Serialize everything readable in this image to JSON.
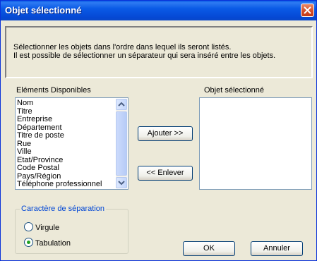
{
  "window": {
    "title": "Objet sélectionné"
  },
  "info": {
    "line1": "Sélectionner les objets dans l'ordre dans lequel ils seront listés.",
    "line2": "Il est possible de sélectionner un séparateur qui sera inséré entre les objets."
  },
  "available": {
    "label": "Eléments Disponibles",
    "items": [
      "Nom",
      "Titre",
      "Entreprise",
      "Département",
      "Titre de poste",
      "Rue",
      "Ville",
      "Etat/Province",
      "Code Postal",
      "Pays/Région",
      "Téléphone professionnel"
    ]
  },
  "selected": {
    "label": "Objet sélectionné"
  },
  "buttons": {
    "add": "Ajouter >>",
    "remove": "<< Enlever",
    "ok": "OK",
    "cancel": "Annuler"
  },
  "separator": {
    "label": "Caractère de séparation",
    "options": [
      {
        "label": "Virgule",
        "checked": false
      },
      {
        "label": "Tabulation",
        "checked": true
      }
    ]
  },
  "colors": {
    "title_bar": "#0a5ae6",
    "dialog_bg": "#ece9d8",
    "group_label": "#0046d5",
    "radio_check": "#21a121"
  }
}
